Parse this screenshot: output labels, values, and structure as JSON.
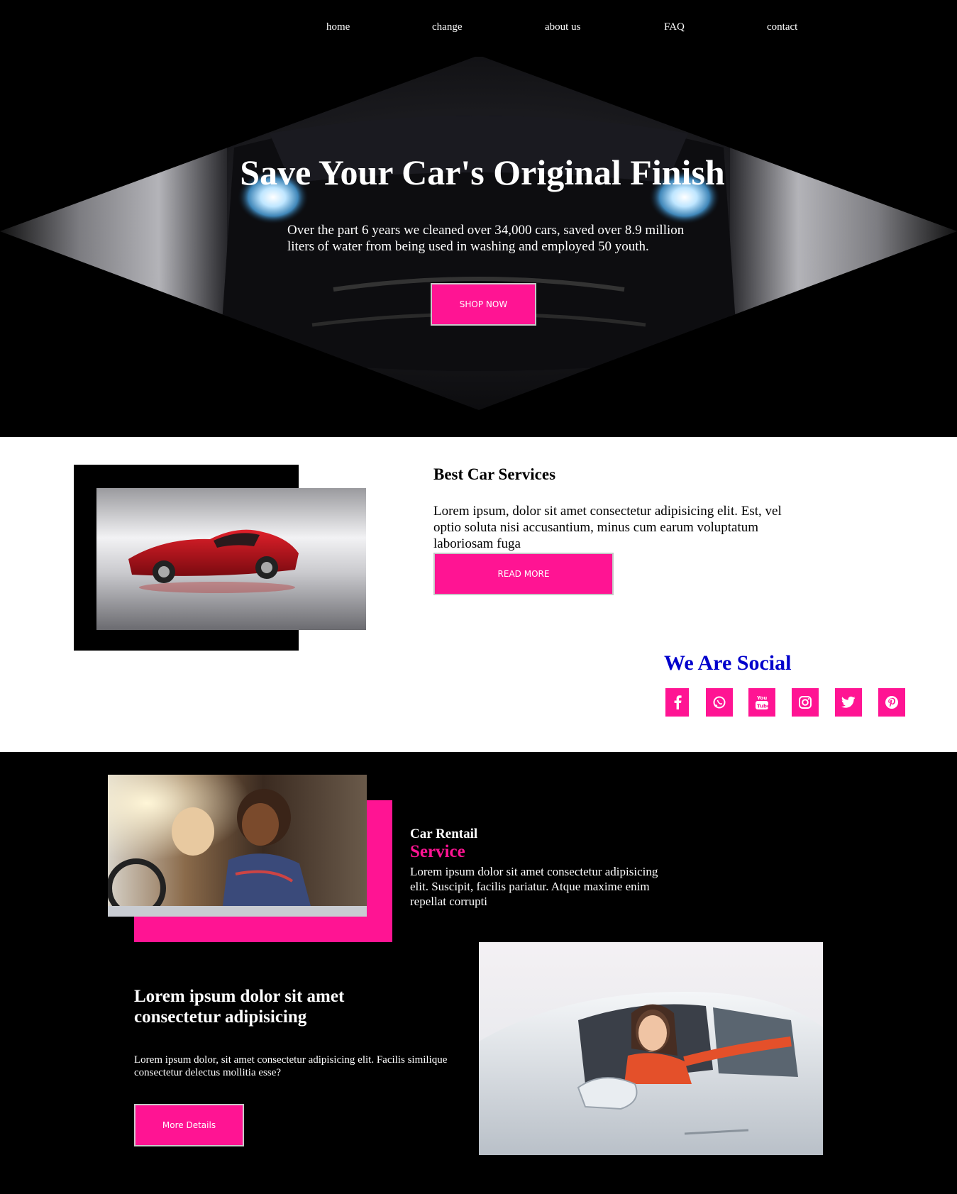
{
  "nav": {
    "items": [
      {
        "label": "home"
      },
      {
        "label": "change"
      },
      {
        "label": "about us"
      },
      {
        "label": "FAQ"
      },
      {
        "label": "contact"
      }
    ]
  },
  "hero": {
    "title": "Save Your Car's Original Finish",
    "subtitle": "Over the part 6 years we cleaned over 34,000 cars, saved over 8.9 million liters of water from being used in washing and employed 50 youth.",
    "button": "SHOP NOW"
  },
  "services": {
    "title": "Best Car Services",
    "text": "Lorem ipsum, dolor sit amet consectetur adipisicing elit. Est, vel optio soluta nisi accusantium, minus cum earum voluptatum laboriosam fuga",
    "button": "READ MORE"
  },
  "social": {
    "title": "We Are Social",
    "icons": [
      "facebook-icon",
      "whatsapp-icon",
      "youtube-icon",
      "instagram-icon",
      "twitter-icon",
      "pinterest-icon"
    ]
  },
  "rental": {
    "title": "Car Rentail",
    "service": "Service",
    "text": "Lorem ipsum dolor sit amet consectetur adipisicing elit. Suscipit, facilis pariatur. Atque maxime enim repellat corrupti"
  },
  "details": {
    "title": "Lorem ipsum dolor sit amet consectetur adipisicing",
    "text": "Lorem ipsum dolor, sit amet consectetur adipisicing elit. Facilis similique consectetur delectus mollitia esse?",
    "button": "More Details"
  },
  "colors": {
    "accent": "#ff1493",
    "social_title": "#0000cc",
    "background_dark": "#000000",
    "background_light": "#ffffff"
  }
}
